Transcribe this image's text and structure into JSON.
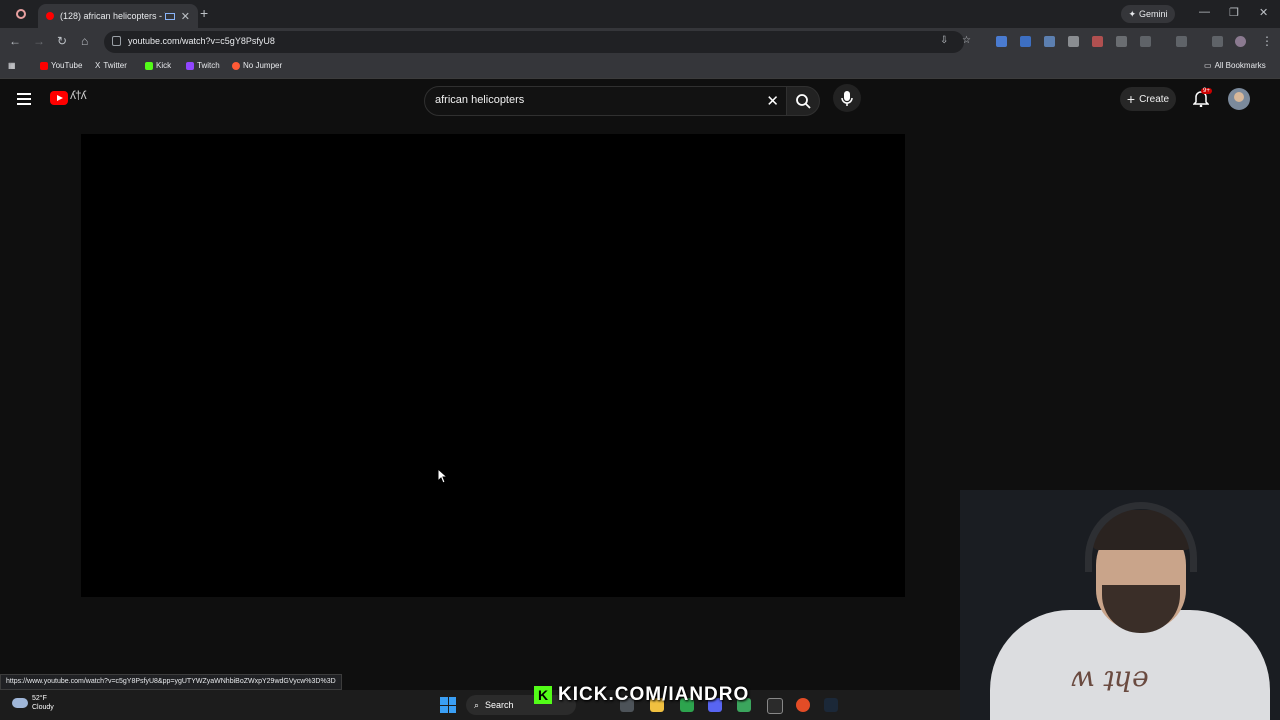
{
  "browser": {
    "tab_title": "(128) african helicopters - Y",
    "gemini_label": "Gemini",
    "url": "youtube.com/watch?v=c5gY8PsfyU8",
    "bookmarks": [
      "YouTube",
      "Twitter",
      "Kick",
      "Twitch",
      "No Jumper"
    ],
    "all_bookmarks_label": "All Bookmarks",
    "status_url": "https://www.youtube.com/watch?v=c5gY8PsfyU8&pp=ygUTYWZyaWNhbiBoZWxpY29wdGVycw%3D%3D"
  },
  "youtube": {
    "search_query": "african helicopters",
    "create_label": "Create",
    "notification_badge": "9+"
  },
  "taskbar": {
    "temperature": "52°F",
    "weather": "Cloudy",
    "search_label": "Search"
  },
  "overlay": {
    "kick_text": "KICK.COM/IANDRO"
  },
  "colors": {
    "page_bg": "#0f0f0f",
    "yt_red": "#ff0000",
    "kick_green": "#53fc18"
  }
}
